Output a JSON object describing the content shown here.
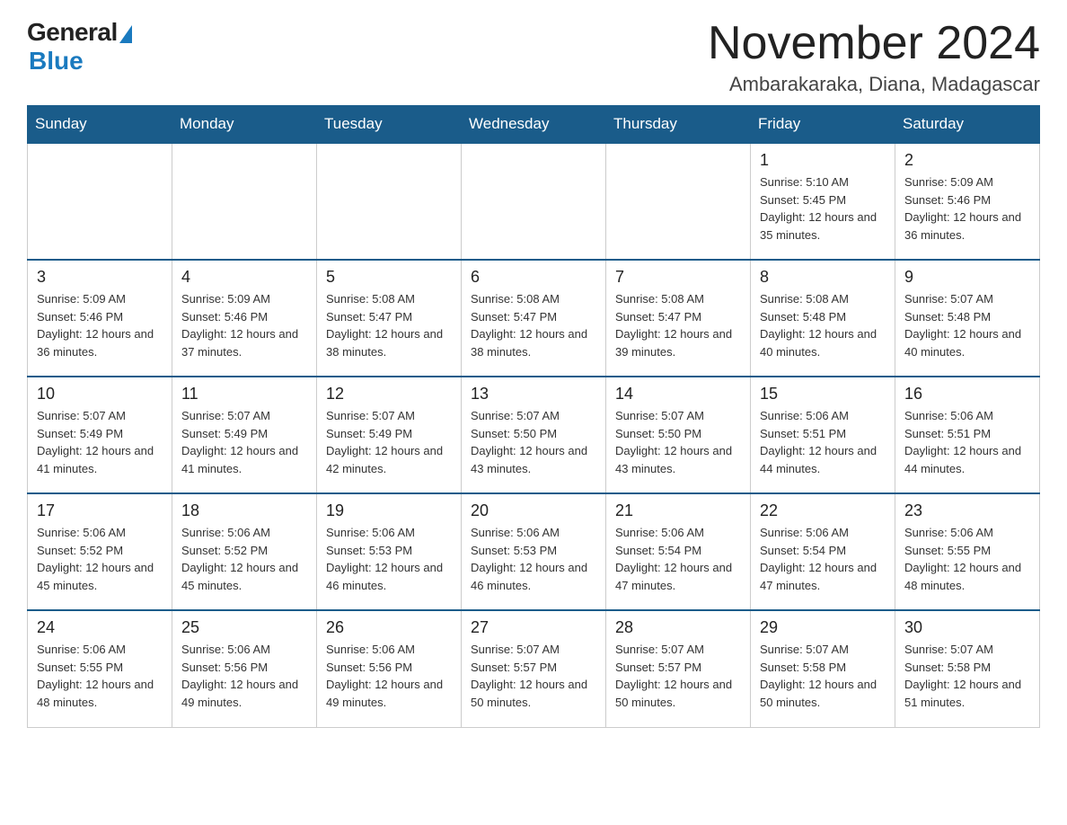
{
  "logo": {
    "general": "General",
    "blue": "Blue"
  },
  "header": {
    "title": "November 2024",
    "location": "Ambarakaraka, Diana, Madagascar"
  },
  "weekdays": [
    "Sunday",
    "Monday",
    "Tuesday",
    "Wednesday",
    "Thursday",
    "Friday",
    "Saturday"
  ],
  "weeks": [
    [
      {
        "day": "",
        "info": ""
      },
      {
        "day": "",
        "info": ""
      },
      {
        "day": "",
        "info": ""
      },
      {
        "day": "",
        "info": ""
      },
      {
        "day": "",
        "info": ""
      },
      {
        "day": "1",
        "info": "Sunrise: 5:10 AM\nSunset: 5:45 PM\nDaylight: 12 hours and 35 minutes."
      },
      {
        "day": "2",
        "info": "Sunrise: 5:09 AM\nSunset: 5:46 PM\nDaylight: 12 hours and 36 minutes."
      }
    ],
    [
      {
        "day": "3",
        "info": "Sunrise: 5:09 AM\nSunset: 5:46 PM\nDaylight: 12 hours and 36 minutes."
      },
      {
        "day": "4",
        "info": "Sunrise: 5:09 AM\nSunset: 5:46 PM\nDaylight: 12 hours and 37 minutes."
      },
      {
        "day": "5",
        "info": "Sunrise: 5:08 AM\nSunset: 5:47 PM\nDaylight: 12 hours and 38 minutes."
      },
      {
        "day": "6",
        "info": "Sunrise: 5:08 AM\nSunset: 5:47 PM\nDaylight: 12 hours and 38 minutes."
      },
      {
        "day": "7",
        "info": "Sunrise: 5:08 AM\nSunset: 5:47 PM\nDaylight: 12 hours and 39 minutes."
      },
      {
        "day": "8",
        "info": "Sunrise: 5:08 AM\nSunset: 5:48 PM\nDaylight: 12 hours and 40 minutes."
      },
      {
        "day": "9",
        "info": "Sunrise: 5:07 AM\nSunset: 5:48 PM\nDaylight: 12 hours and 40 minutes."
      }
    ],
    [
      {
        "day": "10",
        "info": "Sunrise: 5:07 AM\nSunset: 5:49 PM\nDaylight: 12 hours and 41 minutes."
      },
      {
        "day": "11",
        "info": "Sunrise: 5:07 AM\nSunset: 5:49 PM\nDaylight: 12 hours and 41 minutes."
      },
      {
        "day": "12",
        "info": "Sunrise: 5:07 AM\nSunset: 5:49 PM\nDaylight: 12 hours and 42 minutes."
      },
      {
        "day": "13",
        "info": "Sunrise: 5:07 AM\nSunset: 5:50 PM\nDaylight: 12 hours and 43 minutes."
      },
      {
        "day": "14",
        "info": "Sunrise: 5:07 AM\nSunset: 5:50 PM\nDaylight: 12 hours and 43 minutes."
      },
      {
        "day": "15",
        "info": "Sunrise: 5:06 AM\nSunset: 5:51 PM\nDaylight: 12 hours and 44 minutes."
      },
      {
        "day": "16",
        "info": "Sunrise: 5:06 AM\nSunset: 5:51 PM\nDaylight: 12 hours and 44 minutes."
      }
    ],
    [
      {
        "day": "17",
        "info": "Sunrise: 5:06 AM\nSunset: 5:52 PM\nDaylight: 12 hours and 45 minutes."
      },
      {
        "day": "18",
        "info": "Sunrise: 5:06 AM\nSunset: 5:52 PM\nDaylight: 12 hours and 45 minutes."
      },
      {
        "day": "19",
        "info": "Sunrise: 5:06 AM\nSunset: 5:53 PM\nDaylight: 12 hours and 46 minutes."
      },
      {
        "day": "20",
        "info": "Sunrise: 5:06 AM\nSunset: 5:53 PM\nDaylight: 12 hours and 46 minutes."
      },
      {
        "day": "21",
        "info": "Sunrise: 5:06 AM\nSunset: 5:54 PM\nDaylight: 12 hours and 47 minutes."
      },
      {
        "day": "22",
        "info": "Sunrise: 5:06 AM\nSunset: 5:54 PM\nDaylight: 12 hours and 47 minutes."
      },
      {
        "day": "23",
        "info": "Sunrise: 5:06 AM\nSunset: 5:55 PM\nDaylight: 12 hours and 48 minutes."
      }
    ],
    [
      {
        "day": "24",
        "info": "Sunrise: 5:06 AM\nSunset: 5:55 PM\nDaylight: 12 hours and 48 minutes."
      },
      {
        "day": "25",
        "info": "Sunrise: 5:06 AM\nSunset: 5:56 PM\nDaylight: 12 hours and 49 minutes."
      },
      {
        "day": "26",
        "info": "Sunrise: 5:06 AM\nSunset: 5:56 PM\nDaylight: 12 hours and 49 minutes."
      },
      {
        "day": "27",
        "info": "Sunrise: 5:07 AM\nSunset: 5:57 PM\nDaylight: 12 hours and 50 minutes."
      },
      {
        "day": "28",
        "info": "Sunrise: 5:07 AM\nSunset: 5:57 PM\nDaylight: 12 hours and 50 minutes."
      },
      {
        "day": "29",
        "info": "Sunrise: 5:07 AM\nSunset: 5:58 PM\nDaylight: 12 hours and 50 minutes."
      },
      {
        "day": "30",
        "info": "Sunrise: 5:07 AM\nSunset: 5:58 PM\nDaylight: 12 hours and 51 minutes."
      }
    ]
  ]
}
